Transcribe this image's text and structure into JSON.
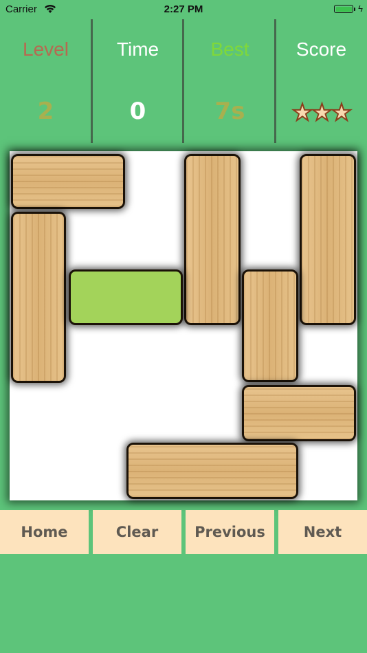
{
  "status_bar": {
    "carrier": "Carrier",
    "time": "2:27 PM"
  },
  "stats": [
    {
      "label": "Level",
      "value": "2",
      "label_color": "#b56a51",
      "value_color": "#a8b04f"
    },
    {
      "label": "Time",
      "value": "0",
      "label_color": "#ffffff",
      "value_color": "#ffffff"
    },
    {
      "label": "Best",
      "value": "7s",
      "label_color": "#7fd83a",
      "value_color": "#a8b04f"
    },
    {
      "label": "Score",
      "label_color": "#ffffff",
      "stars": "★★★",
      "star_count": 3
    }
  ],
  "board": {
    "blocks": [
      {
        "kind": "wood",
        "orientation": "horizontal"
      },
      {
        "kind": "wood",
        "orientation": "vertical"
      },
      {
        "kind": "wood",
        "orientation": "vertical"
      },
      {
        "kind": "wood",
        "orientation": "vertical"
      },
      {
        "kind": "target",
        "orientation": "horizontal",
        "color": "#a3d35a"
      },
      {
        "kind": "wood",
        "orientation": "vertical"
      },
      {
        "kind": "wood",
        "orientation": "horizontal"
      },
      {
        "kind": "wood",
        "orientation": "horizontal"
      }
    ]
  },
  "buttons": {
    "home": "Home",
    "clear": "Clear",
    "previous": "Previous",
    "next": "Next"
  }
}
